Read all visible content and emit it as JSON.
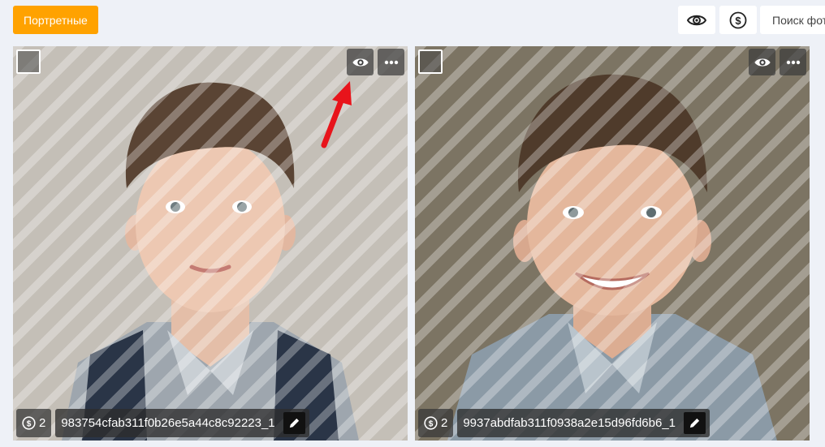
{
  "toolbar": {
    "category_label": "Портретные",
    "search_placeholder": "Поиск фото"
  },
  "photos": [
    {
      "price": "2",
      "filename": "983754cfab311f0b26e5a44c8c92223_1",
      "shirt_color": "#9ea6ae",
      "background_color": "#c4bfb7"
    },
    {
      "price": "2",
      "filename": "9937abdfab311f0938a2e15d96fd6b6_1",
      "shirt_color": "#8b9aa6",
      "background_color": "#6f6656"
    }
  ],
  "colors": {
    "accent": "#ffa200",
    "page_background": "#eef1f7",
    "annotation_arrow": "#e8141b"
  },
  "icons": [
    "eye-icon",
    "dollar-coin-icon",
    "more-dots-icon",
    "pencil-icon",
    "checkbox-icon",
    "red-arrow-annotation"
  ]
}
